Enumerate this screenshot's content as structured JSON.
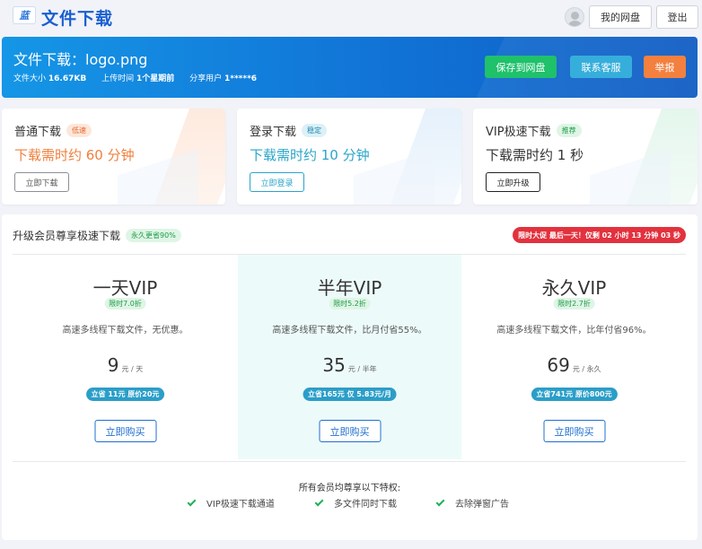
{
  "header": {
    "logo_glyph": "蓝",
    "title": "文件下载",
    "my_disk": "我的网盘",
    "logout": "登出"
  },
  "file": {
    "title": "文件下载：logo.png",
    "size_label": "文件大小",
    "size": "16.67KB",
    "upload_label": "上传时间",
    "upload_time": "1个星期前",
    "sharer_label": "分享用户",
    "sharer": "1*****6"
  },
  "banner_buttons": {
    "save": "保存到网盘",
    "support": "联系客服",
    "report": "举报"
  },
  "cards": [
    {
      "title": "普通下载",
      "tag": "低速",
      "time": "下载需时约 60 分钟",
      "button": "立即下载"
    },
    {
      "title": "登录下载",
      "tag": "稳定",
      "time": "下载需时约 10 分钟",
      "button": "立即登录"
    },
    {
      "title": "VIP极速下载",
      "tag": "推荐",
      "time": "下载需时约 1 秒",
      "button": "立即升级"
    }
  ],
  "vip": {
    "heading": "升级会员尊享极速下载",
    "heading_tag": "永久更省90%",
    "promo": "限时大促 最后一天！仅剩 02 小时 13 分钟 03 秒",
    "plans": [
      {
        "name": "一天VIP",
        "tag": "限时7.0折",
        "desc": "高速多线程下载文件，无优惠。",
        "price": "9",
        "unit": "元 / 天",
        "save": "立省 11元 原价20元",
        "button": "立即购买"
      },
      {
        "name": "半年VIP",
        "tag": "限时5.2折",
        "desc": "高速多线程下载文件，比月付省55%。",
        "price": "35",
        "unit": "元 / 半年",
        "save": "立省165元 仅 5.83元/月",
        "button": "立即购买"
      },
      {
        "name": "永久VIP",
        "tag": "限时2.7折",
        "desc": "高速多线程下载文件，比年付省96%。",
        "price": "69",
        "unit": "元 / 永久",
        "save": "立省741元 原价800元",
        "button": "立即购买"
      }
    ],
    "privileges_title": "所有会员均尊享以下特权:",
    "privileges": [
      "VIP极速下载通道",
      "多文件同时下载",
      "去除弹窗广告"
    ]
  },
  "colors": {
    "brand_blue": "#1a5fd0",
    "save_green": "#1fc16b",
    "support_teal": "#36aedb",
    "report_orange": "#f3803f",
    "slow_orange": "#f07f3c",
    "login_teal": "#2aa5c9",
    "promo_red": "#e2323e"
  }
}
